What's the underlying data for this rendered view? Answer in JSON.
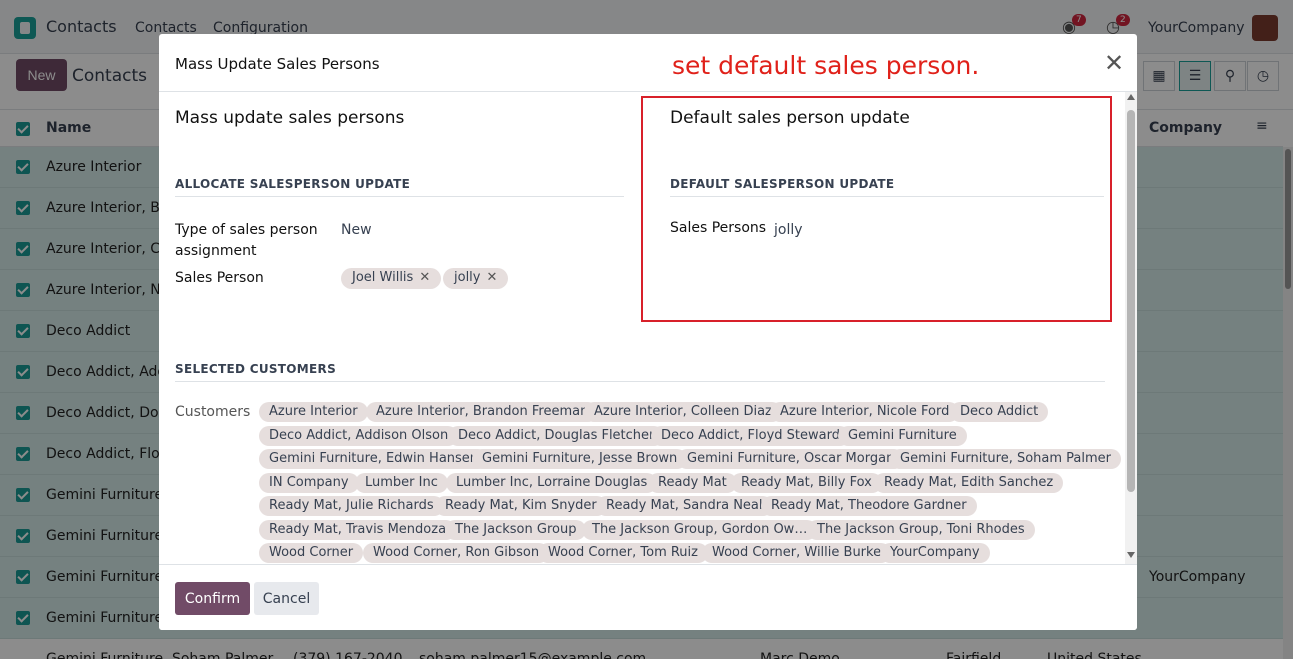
{
  "app": {
    "name": "Contacts",
    "menu": [
      "Contacts",
      "Configuration"
    ],
    "messages_badge": "7",
    "activity_badge": "2",
    "company": "YourCompany"
  },
  "control": {
    "new_label": "New",
    "breadcrumb": "Contacts"
  },
  "list": {
    "header_name": "Name",
    "header_company": "Company",
    "rows": [
      {
        "name": "Azure Interior",
        "company": ""
      },
      {
        "name": "Azure Interior, Bra",
        "company": ""
      },
      {
        "name": "Azure Interior, Col",
        "company": ""
      },
      {
        "name": "Azure Interior, Nic",
        "company": ""
      },
      {
        "name": "Deco Addict",
        "company": ""
      },
      {
        "name": "Deco Addict, Addi",
        "company": ""
      },
      {
        "name": "Deco Addict, Doug",
        "company": ""
      },
      {
        "name": "Deco Addict, Floy",
        "company": ""
      },
      {
        "name": "Gemini Furniture",
        "company": ""
      },
      {
        "name": "Gemini Furniture,",
        "company": ""
      },
      {
        "name": "Gemini Furniture,",
        "company": "YourCompany"
      },
      {
        "name": "Gemini Furniture,",
        "company": ""
      }
    ],
    "peek_row": {
      "name": "Gemini Furniture, Soham Palmer",
      "phone": "(379) 167-2040",
      "email": "soham.palmer15@example.com",
      "salesperson": "Marc Demo",
      "city": "Fairfield",
      "country": "United States"
    }
  },
  "modal": {
    "title": "Mass Update Sales Persons",
    "annotation": "set default sales person.",
    "left": {
      "heading": "Mass update sales persons",
      "subheading": "ALLOCATE SALESPERSON UPDATE",
      "type_label": "Type of sales person assignment",
      "type_value": "New",
      "sales_person_label": "Sales Person",
      "sales_person_tags": [
        "Joel Willis",
        "jolly"
      ]
    },
    "right": {
      "heading": "Default sales person update",
      "subheading": "DEFAULT SALESPERSON UPDATE",
      "sales_persons_label": "Sales Persons",
      "sales_persons_value": "jolly"
    },
    "selected": {
      "subheading": "SELECTED CUSTOMERS",
      "customers_label": "Customers",
      "customers": [
        "Azure Interior",
        "Azure Interior, Brandon Freeman",
        "Azure Interior, Colleen Diaz",
        "Azure Interior, Nicole Ford",
        "Deco Addict",
        "Deco Addict, Addison Olson",
        "Deco Addict, Douglas Fletcher",
        "Deco Addict, Floyd Steward",
        "Gemini Furniture",
        "Gemini Furniture, Edwin Hansen",
        "Gemini Furniture, Jesse Brown",
        "Gemini Furniture, Oscar Morgan",
        "Gemini Furniture, Soham Palmer",
        "IN Company",
        "Lumber Inc",
        "Lumber Inc, Lorraine Douglas",
        "Ready Mat",
        "Ready Mat, Billy Fox",
        "Ready Mat, Edith Sanchez",
        "Ready Mat, Julie Richards",
        "Ready Mat, Kim Snyder",
        "Ready Mat, Sandra Neal",
        "Ready Mat, Theodore Gardner",
        "Ready Mat, Travis Mendoza",
        "The Jackson Group",
        "The Jackson Group, Gordon Ow…",
        "The Jackson Group, Toni Rhodes",
        "Wood Corner",
        "Wood Corner, Ron Gibson",
        "Wood Corner, Tom Ruiz",
        "Wood Corner, Willie Burke",
        "YourCompany"
      ]
    },
    "confirm_label": "Confirm",
    "cancel_label": "Cancel"
  }
}
